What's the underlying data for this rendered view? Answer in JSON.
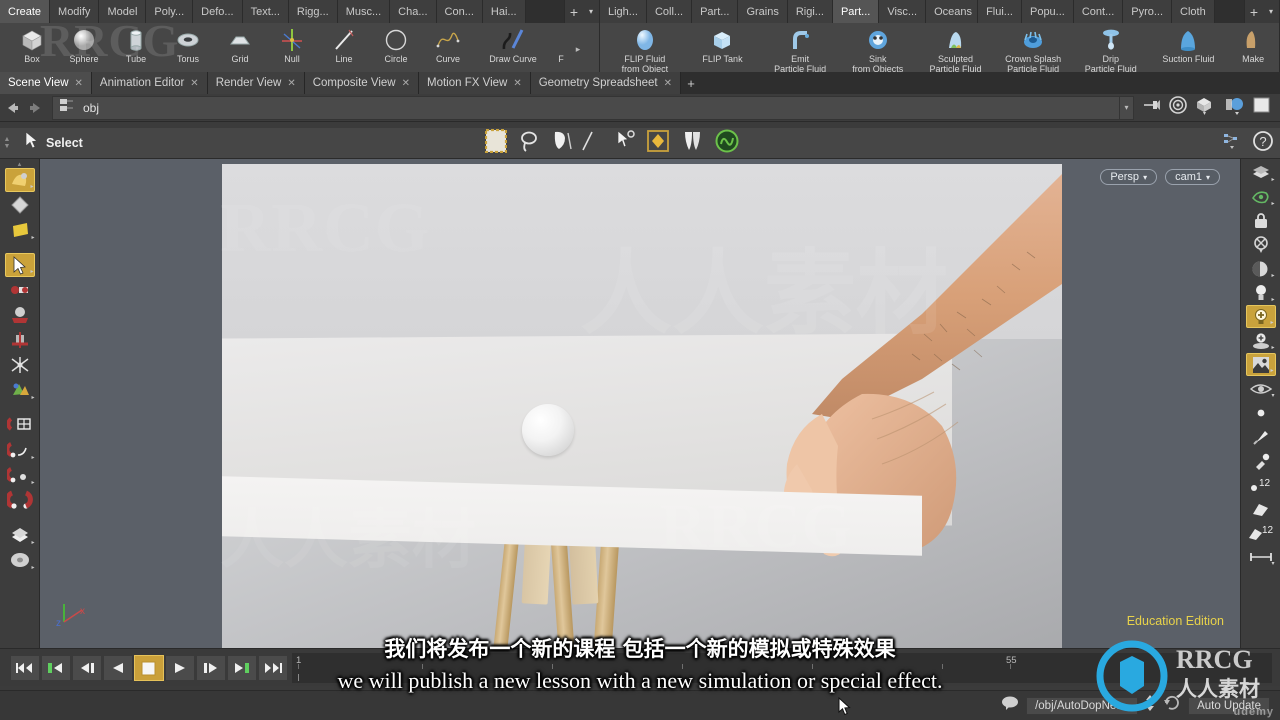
{
  "shelf": {
    "left_tabs": [
      "Create",
      "Modify",
      "Model",
      "Poly...",
      "Defo...",
      "Text...",
      "Rigg...",
      "Musc...",
      "Cha...",
      "Con...",
      "Hai..."
    ],
    "left_active": "Create",
    "right_tabs": [
      "Ligh...",
      "Coll...",
      "Part...",
      "Grains",
      "Rigi...",
      "Part...",
      "Visc...",
      "Oceans",
      "Flui...",
      "Popu...",
      "Cont...",
      "Pyro...",
      "Cloth"
    ],
    "right_active_index": 5,
    "add_label": "+",
    "caret_label": "▾",
    "left_items": [
      {
        "label": "Box",
        "icon": "box-icon"
      },
      {
        "label": "Sphere",
        "icon": "sphere-icon"
      },
      {
        "label": "Tube",
        "icon": "tube-icon"
      },
      {
        "label": "Torus",
        "icon": "torus-icon"
      },
      {
        "label": "Grid",
        "icon": "grid-icon"
      },
      {
        "label": "Null",
        "icon": "null-icon"
      },
      {
        "label": "Line",
        "icon": "line-icon"
      },
      {
        "label": "Circle",
        "icon": "circle-icon"
      },
      {
        "label": "Curve",
        "icon": "curve-icon"
      },
      {
        "label": "Draw Curve",
        "icon": "draw-curve-icon"
      },
      {
        "label": "F",
        "icon": "partial-icon"
      }
    ],
    "right_items": [
      {
        "label": "FLIP Fluid\nfrom Object",
        "icon": "flip-fluid-from-object-icon"
      },
      {
        "label": "FLIP Tank",
        "icon": "flip-tank-icon"
      },
      {
        "label": "Emit\nParticle Fluid",
        "icon": "emit-particle-fluid-icon"
      },
      {
        "label": "Sink\nfrom Objects",
        "icon": "sink-from-objects-icon"
      },
      {
        "label": "Sculpted\nParticle Fluid",
        "icon": "sculpted-particle-fluid-icon"
      },
      {
        "label": "Crown Splash\nParticle Fluid",
        "icon": "crown-splash-particle-fluid-icon"
      },
      {
        "label": "Drip\nParticle Fluid",
        "icon": "drip-particle-fluid-icon"
      },
      {
        "label": "Suction Fluid",
        "icon": "suction-fluid-icon"
      },
      {
        "label": "Make",
        "icon": "make-icon"
      }
    ]
  },
  "pane_tabs": [
    {
      "label": "Scene View",
      "active": true
    },
    {
      "label": "Animation Editor",
      "active": false
    },
    {
      "label": "Render View",
      "active": false
    },
    {
      "label": "Composite View",
      "active": false
    },
    {
      "label": "Motion FX View",
      "active": false
    },
    {
      "label": "Geometry Spreadsheet",
      "active": false
    }
  ],
  "pane_tab_add": "+",
  "pane_tab_close": "✕",
  "pathbar": {
    "back_icon": "back-arrow-icon",
    "forward_icon": "forward-arrow-icon",
    "node_icon": "network-node-icon",
    "path": "obj",
    "dropdown_caret": "▾",
    "right_icons": [
      "pin-icon",
      "target-icon",
      "object-display-icon",
      "material-display-icon",
      "viewport-display-icon"
    ]
  },
  "select_toolbar": {
    "label": "Select",
    "cursor_icon": "arrow-cursor-icon",
    "mode_icons": [
      "box-select-icon",
      "lasso-select-icon",
      "brush-select-icon",
      "laser-select-icon"
    ],
    "tool_icons": [
      "select-mode-icon",
      "visualize-icon",
      "group-icon",
      "material-sphere-icon"
    ],
    "right_icons": [
      "tree-view-icon",
      "help-icon"
    ]
  },
  "left_toolbar": [
    {
      "name": "view-tool",
      "selected": true
    },
    {
      "name": "snapshot-tool",
      "selected": false
    },
    {
      "name": "flipbook-tool",
      "selected": false
    },
    {
      "name": "select-tool",
      "selected": true
    },
    {
      "name": "handle-tool",
      "selected": false
    },
    {
      "name": "move-tool",
      "selected": false
    },
    {
      "name": "rotate-tool",
      "selected": false
    },
    {
      "name": "scale-tool",
      "selected": false
    },
    {
      "name": "pose-tool",
      "selected": false
    },
    {
      "name": "transform-axis-tool",
      "selected": false
    },
    {
      "name": "snap-grid-tool",
      "selected": false
    },
    {
      "name": "snap-primitive-tool",
      "selected": false
    },
    {
      "name": "snap-point-tool",
      "selected": false
    },
    {
      "name": "snap-multi-tool",
      "selected": false
    },
    {
      "name": "layers-tool",
      "selected": false
    },
    {
      "name": "wheel-tool",
      "selected": false
    }
  ],
  "right_toolbar": [
    {
      "name": "display-shading-icon",
      "selected": false
    },
    {
      "name": "ghost-display-icon",
      "selected": false
    },
    {
      "name": "lock-camera-icon",
      "selected": false
    },
    {
      "name": "no-camera-icon",
      "selected": false
    },
    {
      "name": "contrast-icon",
      "selected": false
    },
    {
      "name": "headlight-icon",
      "selected": false
    },
    {
      "name": "add-light-icon",
      "selected": true
    },
    {
      "name": "place-light-icon",
      "selected": false
    },
    {
      "name": "background-image-icon",
      "selected": true
    },
    {
      "name": "visibility-icon",
      "selected": false
    },
    {
      "name": "point-display-icon",
      "selected": false
    },
    {
      "name": "paint-icon",
      "selected": false
    },
    {
      "name": "eyedropper-icon",
      "selected": false
    },
    {
      "name": "point-number-icon",
      "selected": false,
      "badge": "12"
    },
    {
      "name": "primitive-display-icon",
      "selected": false
    },
    {
      "name": "primitive-number-icon",
      "selected": false,
      "badge": "12"
    },
    {
      "name": "measure-icon",
      "selected": false
    }
  ],
  "viewport": {
    "persp_label": "Persp",
    "camera_label": "cam1",
    "dropdown_caret": "▾",
    "edition": "Education Edition",
    "axis": {
      "x": "x",
      "y": "y",
      "z": "z",
      "x_color": "#c84a4a",
      "y_color": "#49b23b",
      "z_color": "#4a6fd0"
    },
    "background_color": "#5b6068"
  },
  "timeline": {
    "buttons": [
      {
        "name": "jump-to-start-button",
        "glyph": "start"
      },
      {
        "name": "previous-key-button",
        "glyph": "prevkey"
      },
      {
        "name": "step-back-button",
        "glyph": "stepback"
      },
      {
        "name": "play-backwards-button",
        "glyph": "playback"
      },
      {
        "name": "stop-button",
        "glyph": "stop",
        "active": true
      },
      {
        "name": "play-forward-button",
        "glyph": "play"
      },
      {
        "name": "step-forward-button",
        "glyph": "stepfwd"
      },
      {
        "name": "next-key-button",
        "glyph": "nextkey"
      },
      {
        "name": "jump-to-end-button",
        "glyph": "end"
      }
    ],
    "ticks": [
      "1",
      "55"
    ],
    "range_color": "#2a7fd4"
  },
  "status_bar": {
    "node_path": "/obj/AutoDopNet...",
    "update_mode": "Auto Update",
    "comment_icon": "comment-bubble-icon",
    "updown_icon": "up-down-arrows-icon",
    "refresh_icon": "refresh-icon"
  },
  "subtitles": {
    "chinese": "我们将发布一个新的课程 包括一个新的模拟或特殊效果",
    "english": "we will publish a new lesson with a new simulation or special effect."
  },
  "watermarks": {
    "brand": "RRCG",
    "cn": "人人素材",
    "udemy": "udemy"
  }
}
